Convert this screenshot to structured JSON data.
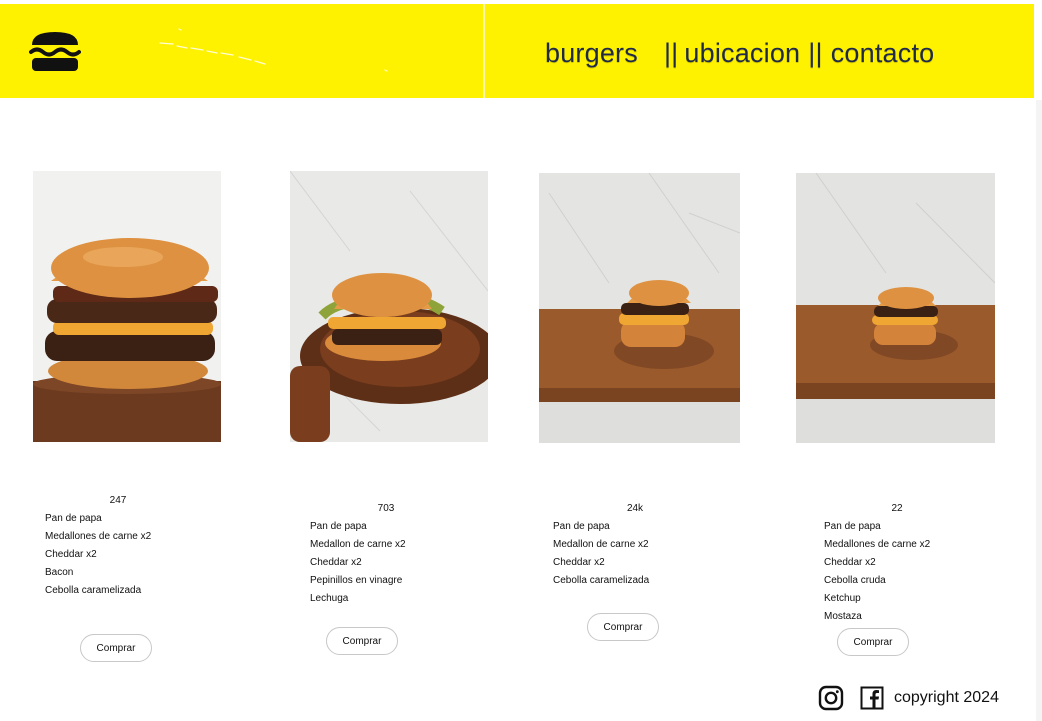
{
  "header": {
    "logo_icon": "burger-icon",
    "accent_color": "#fff200",
    "nav": {
      "burgers": "burgers",
      "sep1": "||",
      "ubicacion": "ubicacion",
      "sep2": "||",
      "contacto": "contacto"
    }
  },
  "products": [
    {
      "count": "247",
      "ingredients": [
        "Pan de papa",
        "Medallones de carne x2",
        "Cheddar x2",
        "Bacon",
        "Cebolla caramelizada"
      ],
      "button": "Comprar"
    },
    {
      "count": "703",
      "ingredients": [
        "Pan de papa",
        "Medallon de carne x2",
        "Cheddar x2",
        "Pepinillos en vinagre",
        "Lechuga"
      ],
      "button": "Comprar"
    },
    {
      "count": "24k",
      "ingredients": [
        "Pan de papa",
        "Medallon de carne x2",
        "Cheddar x2",
        "Cebolla caramelizada"
      ],
      "button": "Comprar"
    },
    {
      "count": "22",
      "ingredients": [
        "Pan de papa",
        "Medallones de carne x2",
        "Cheddar x2",
        "Cebolla cruda",
        "Ketchup",
        "Mostaza"
      ],
      "button": "Comprar"
    }
  ],
  "footer": {
    "instagram_icon": "instagram-icon",
    "facebook_icon": "facebook-icon",
    "copyright": "copyright 2024"
  }
}
